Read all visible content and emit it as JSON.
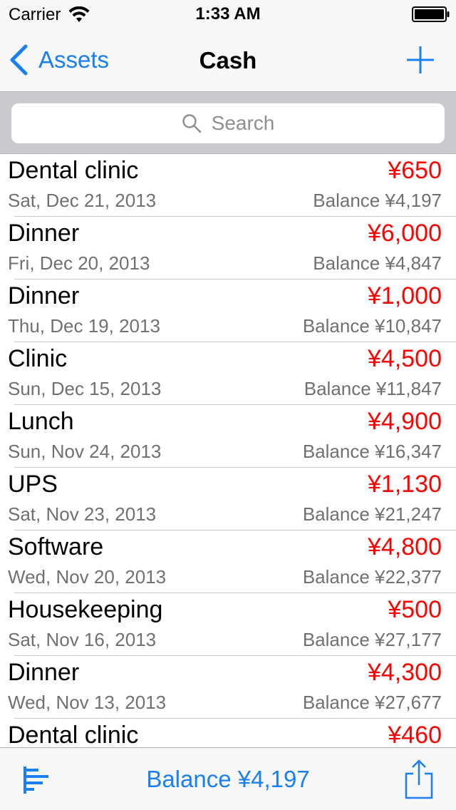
{
  "status_bar": {
    "carrier": "Carrier",
    "time": "1:33 AM"
  },
  "nav": {
    "back_label": "Assets",
    "title": "Cash",
    "add_icon": "plus-icon"
  },
  "search": {
    "placeholder": "Search"
  },
  "colors": {
    "accent": "#1a7ff0",
    "amount": "#ff0000",
    "secondary_text": "#707070"
  },
  "transactions": [
    {
      "title": "Dental clinic",
      "amount": "¥650",
      "date": "Sat, Dec 21, 2013",
      "balance": "Balance ¥4,197"
    },
    {
      "title": "Dinner",
      "amount": "¥6,000",
      "date": "Fri, Dec 20, 2013",
      "balance": "Balance ¥4,847"
    },
    {
      "title": "Dinner",
      "amount": "¥1,000",
      "date": "Thu, Dec 19, 2013",
      "balance": "Balance ¥10,847"
    },
    {
      "title": "Clinic",
      "amount": "¥4,500",
      "date": "Sun, Dec 15, 2013",
      "balance": "Balance ¥11,847"
    },
    {
      "title": "Lunch",
      "amount": "¥4,900",
      "date": "Sun, Nov 24, 2013",
      "balance": "Balance ¥16,347"
    },
    {
      "title": "UPS",
      "amount": "¥1,130",
      "date": "Sat, Nov 23, 2013",
      "balance": "Balance ¥21,247"
    },
    {
      "title": "Software",
      "amount": "¥4,800",
      "date": "Wed, Nov 20, 2013",
      "balance": "Balance ¥22,377"
    },
    {
      "title": "Housekeeping",
      "amount": "¥500",
      "date": "Sat, Nov 16, 2013",
      "balance": "Balance ¥27,177"
    },
    {
      "title": "Dinner",
      "amount": "¥4,300",
      "date": "Wed, Nov 13, 2013",
      "balance": "Balance ¥27,677"
    },
    {
      "title": "Dental clinic",
      "amount": "¥460",
      "date": "",
      "balance": ""
    }
  ],
  "toolbar": {
    "balance_label": "Balance ¥4,197",
    "left_icon": "chart-icon",
    "right_icon": "share-icon"
  }
}
